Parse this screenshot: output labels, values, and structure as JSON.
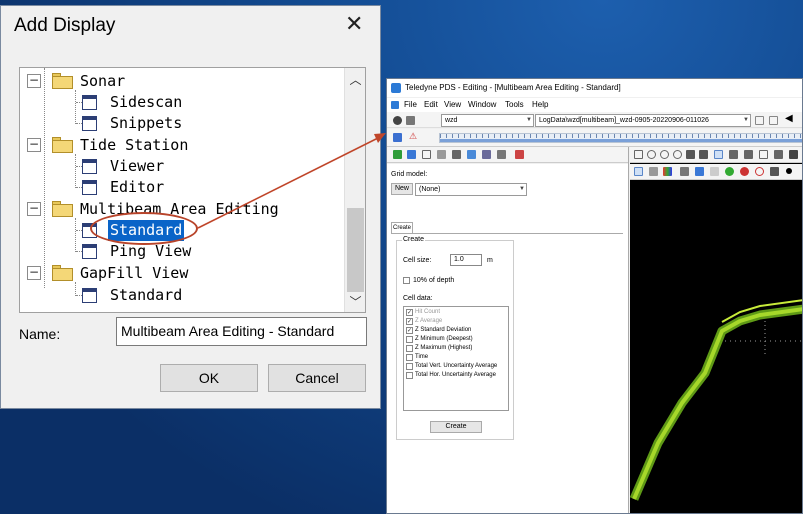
{
  "dialog": {
    "title": "Add Display",
    "tree": [
      {
        "label": "Sonar",
        "type": "folder"
      },
      {
        "label": "Sidescan",
        "type": "item"
      },
      {
        "label": "Snippets",
        "type": "item"
      },
      {
        "label": "Tide Station",
        "type": "folder"
      },
      {
        "label": "Viewer",
        "type": "item"
      },
      {
        "label": "Editor",
        "type": "item"
      },
      {
        "label": "Multibeam Area Editing",
        "type": "folder"
      },
      {
        "label": "Standard",
        "type": "item",
        "selected": true
      },
      {
        "label": "Ping View",
        "type": "item"
      },
      {
        "label": "GapFill View",
        "type": "folder"
      },
      {
        "label": "Standard",
        "type": "item"
      }
    ],
    "name_label": "Name:",
    "name_value": "Multibeam Area Editing - Standard",
    "ok_label": "OK",
    "cancel_label": "Cancel"
  },
  "pds": {
    "title": "Teledyne PDS - Editing - [Multibeam Area Editing - Standard]",
    "menu": [
      "File",
      "Edit",
      "View",
      "Window",
      "Tools",
      "Help"
    ],
    "vessel_combo": "wzd",
    "log_combo": "LogData\\wzd[multibeam]_wzd-0905-20220906-011026",
    "grid_model_label": "Grid model:",
    "new_button": "New",
    "grid_combo": "(None)",
    "create_tab": "Create",
    "create_group": "Create",
    "cell_size_label": "Cell size:",
    "cell_size_value": "1.0",
    "cell_size_unit": "m",
    "ten_percent_label": "10% of depth",
    "cell_data_label": "Cell data:",
    "cell_data": [
      {
        "label": "Hit Count",
        "checked": true,
        "disabled": true
      },
      {
        "label": "Z Average",
        "checked": true,
        "disabled": true
      },
      {
        "label": "Z Standard Deviation",
        "checked": true,
        "disabled": false
      },
      {
        "label": "Z Minimum (Deepest)",
        "checked": false,
        "disabled": false
      },
      {
        "label": "Z Maximum (Highest)",
        "checked": false,
        "disabled": false
      },
      {
        "label": "Time",
        "checked": false,
        "disabled": false
      },
      {
        "label": "Total Vert. Uncertainty Average",
        "checked": false,
        "disabled": false
      },
      {
        "label": "Total Hor. Uncertainty Average",
        "checked": false,
        "disabled": false
      }
    ],
    "create_button": "Create"
  },
  "colors": {
    "selection": "#0a64c8",
    "annotation": "#b8442a",
    "track": "#7fc21e"
  }
}
